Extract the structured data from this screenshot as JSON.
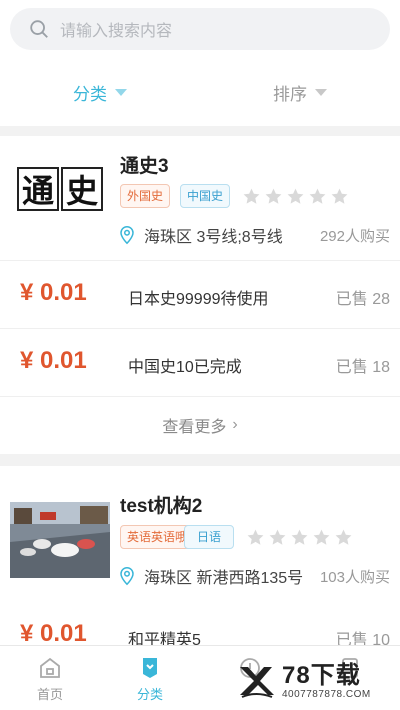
{
  "search": {
    "placeholder": "请输入搜索内容"
  },
  "filters": [
    {
      "label": "分类",
      "active": true
    },
    {
      "label": "排序",
      "active": false
    }
  ],
  "institutions": [
    {
      "name": "通史3",
      "tags": [
        "外国史",
        "中国史"
      ],
      "rating": 0,
      "location": "海珠区 3号线;8号线",
      "buyers": "292人购买",
      "thumb_text": "通史",
      "courses": [
        {
          "price": "¥ 0.01",
          "name": "日本史99999待使用",
          "sold": "已售 28"
        },
        {
          "price": "¥ 0.01",
          "name": "中国史10已完成",
          "sold": "已售 18"
        }
      ],
      "more": "查看更多"
    },
    {
      "name": "test机构2",
      "tags": [
        "英语英语哦",
        "日语"
      ],
      "rating": 0,
      "location": "海珠区 新港西路135号",
      "buyers": "103人购买",
      "courses": [
        {
          "price": "¥ 0.01",
          "name": "和平精英5",
          "sold": "已售 10"
        }
      ]
    }
  ],
  "tabbar": [
    {
      "label": "首页",
      "icon": "home-icon",
      "active": false
    },
    {
      "label": "分类",
      "icon": "category-icon",
      "active": true
    },
    {
      "label": "",
      "icon": "discover-icon",
      "active": false
    },
    {
      "label": "",
      "icon": "profile-icon",
      "active": false
    }
  ],
  "watermark": {
    "title": "78下载",
    "sub": "4007787878.COM"
  },
  "colors": {
    "accent": "#3ab6d8",
    "price": "#e0562e",
    "tag_orange": "#e36b3a",
    "tag_blue": "#3aa0d0"
  }
}
